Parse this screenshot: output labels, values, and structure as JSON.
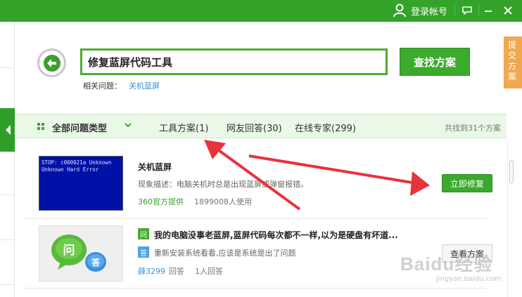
{
  "topbar": {
    "login_label": "登录帐号",
    "icons": [
      "user-icon",
      "chat-icon",
      "minimize-icon",
      "close-icon"
    ]
  },
  "search": {
    "value": "修复蓝屏代码工具",
    "button_label": "查找方案",
    "related_label": "相关问题：",
    "related_link": "关机蓝屏"
  },
  "side_tab": {
    "chars": [
      "提",
      "交",
      "方",
      "案"
    ]
  },
  "filter": {
    "all_label": "全部问题类型",
    "tabs": [
      {
        "label": "工具方案(1)"
      },
      {
        "label": "网友回答(30)"
      },
      {
        "label": "在线专家(299)"
      }
    ],
    "result_count": "共找到31个方案"
  },
  "results": {
    "first": {
      "thumb_text": "STOP: c000021a Unknown\nUnknown Hard Error",
      "title": "关机蓝屏",
      "description": "现象描述：电脑关机时总是出现蓝屏或弹窗报错。",
      "source": "360官方提供",
      "users": "1899008人使用",
      "button_label": "立即修复"
    },
    "second": {
      "q_badge": "问",
      "a_badge": "答",
      "title": "我的电脑没事老蓝屏,蓝屏代码每次都不一样,以为是硬盘有坏道...",
      "answer": "重新安装系统看看,应该是系统是出了问题",
      "user": "薛3299",
      "answer_label": "回答",
      "users": "1人回答",
      "button_label": "查看方案",
      "thumb_q": "问",
      "thumb_a": "答"
    }
  },
  "watermark": {
    "text": "Baidu经验",
    "url": "jingyan.baidu.com"
  },
  "colors": {
    "brand_green": "#33a329",
    "accent_orange": "#f0a94e",
    "link_blue": "#3c8fd0",
    "annotation_red": "#e8323c"
  }
}
